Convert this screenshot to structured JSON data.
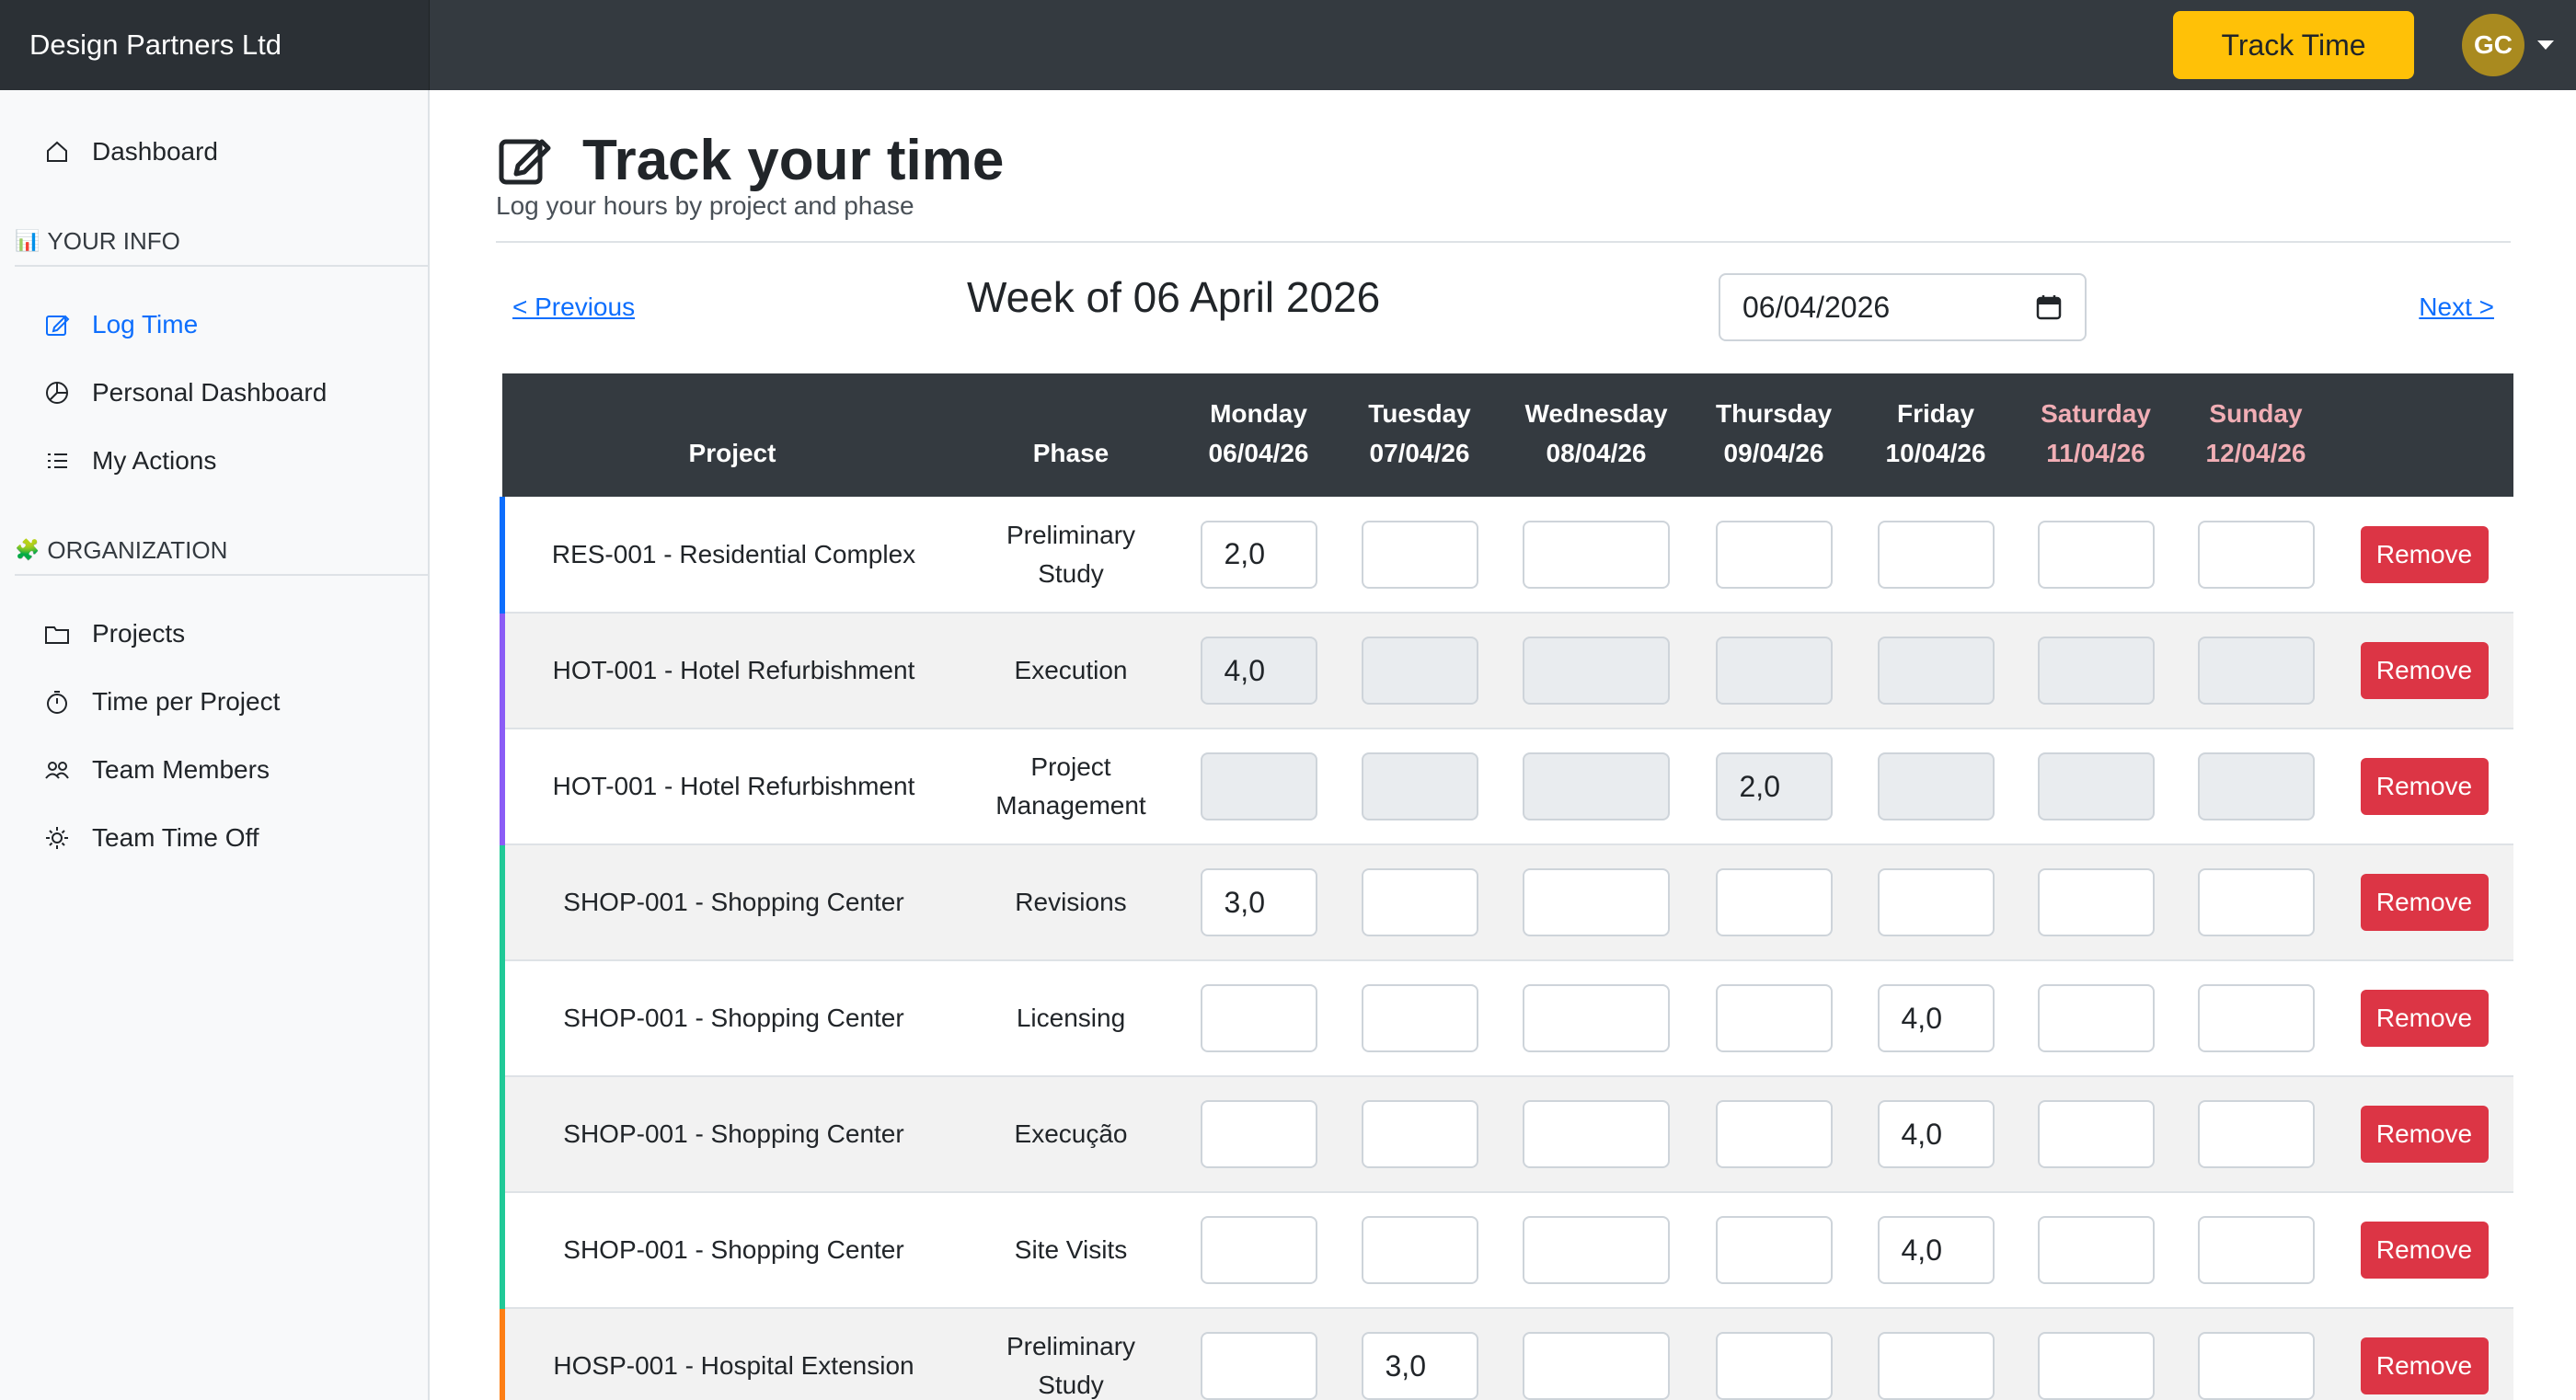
{
  "app": {
    "name": "Design Partners Ltd",
    "user_initials": "GC",
    "track_button": "Track Time"
  },
  "colors": {
    "topbar": "#343a40",
    "accent": "#ffc107",
    "link": "#0d6efd",
    "danger": "#dc3545",
    "avatar": "#a98a1f",
    "weekend_header": "#f1aeb5"
  },
  "sidebar": {
    "dashboard": {
      "label": "Dashboard",
      "icon": "home-icon"
    },
    "sections": [
      {
        "title": "YOUR INFO",
        "icon": "bar-chart-emoji-icon",
        "items": [
          {
            "label": "Log Time",
            "icon": "edit-icon",
            "active": true
          },
          {
            "label": "Personal Dashboard",
            "icon": "pie-chart-icon",
            "active": false
          },
          {
            "label": "My Actions",
            "icon": "list-icon",
            "active": false
          }
        ]
      },
      {
        "title": "ORGANIZATION",
        "icon": "puzzle-emoji-icon",
        "items": [
          {
            "label": "Projects",
            "icon": "folder-icon"
          },
          {
            "label": "Time per Project",
            "icon": "stopwatch-icon"
          },
          {
            "label": "Team Members",
            "icon": "people-icon"
          },
          {
            "label": "Team Time Off",
            "icon": "sun-icon"
          }
        ]
      }
    ]
  },
  "page": {
    "title": "Track your time",
    "subtitle": "Log your hours by project and phase",
    "prev_label": "< Previous",
    "next_label": "Next >",
    "week_title": "Week of 06 April 2026",
    "date_value": "06/04/2026"
  },
  "table": {
    "headers": {
      "project": "Project",
      "phase": "Phase",
      "days": [
        {
          "name": "Monday",
          "date": "06/04/26",
          "weekend": false
        },
        {
          "name": "Tuesday",
          "date": "07/04/26",
          "weekend": false
        },
        {
          "name": "Wednesday",
          "date": "08/04/26",
          "weekend": false
        },
        {
          "name": "Thursday",
          "date": "09/04/26",
          "weekend": false
        },
        {
          "name": "Friday",
          "date": "10/04/26",
          "weekend": false
        },
        {
          "name": "Saturday",
          "date": "11/04/26",
          "weekend": true
        },
        {
          "name": "Sunday",
          "date": "12/04/26",
          "weekend": true
        }
      ]
    },
    "remove_label": "Remove",
    "rows": [
      {
        "project": "RES-001 - Residential Complex",
        "phase": "Preliminary Study",
        "color": "#0d6efd",
        "disabled": false,
        "hours": [
          "2,0",
          "",
          "",
          "",
          "",
          "",
          ""
        ]
      },
      {
        "project": "HOT-001 - Hotel Refurbishment",
        "phase": "Execution",
        "color": "#8b5cf6",
        "disabled": true,
        "hours": [
          "4,0",
          "",
          "",
          "",
          "",
          "",
          ""
        ]
      },
      {
        "project": "HOT-001 - Hotel Refurbishment",
        "phase": "Project Management",
        "color": "#8b5cf6",
        "disabled": true,
        "hours": [
          "",
          "",
          "",
          "2,0",
          "",
          "",
          ""
        ]
      },
      {
        "project": "SHOP-001 - Shopping Center",
        "phase": "Revisions",
        "color": "#20c997",
        "disabled": false,
        "hours": [
          "3,0",
          "",
          "",
          "",
          "",
          "",
          ""
        ]
      },
      {
        "project": "SHOP-001 - Shopping Center",
        "phase": "Licensing",
        "color": "#20c997",
        "disabled": false,
        "hours": [
          "",
          "",
          "",
          "",
          "4,0",
          "",
          ""
        ]
      },
      {
        "project": "SHOP-001 - Shopping Center",
        "phase": "Execução",
        "color": "#20c997",
        "disabled": false,
        "hours": [
          "",
          "",
          "",
          "",
          "4,0",
          "",
          ""
        ]
      },
      {
        "project": "SHOP-001 - Shopping Center",
        "phase": "Site Visits",
        "color": "#20c997",
        "disabled": false,
        "hours": [
          "",
          "",
          "",
          "",
          "4,0",
          "",
          ""
        ]
      },
      {
        "project": "HOSP-001 - Hospital Extension",
        "phase": "Preliminary Study",
        "color": "#fd7e14",
        "disabled": false,
        "hours": [
          "",
          "3,0",
          "",
          "",
          "",
          "",
          ""
        ]
      }
    ]
  }
}
